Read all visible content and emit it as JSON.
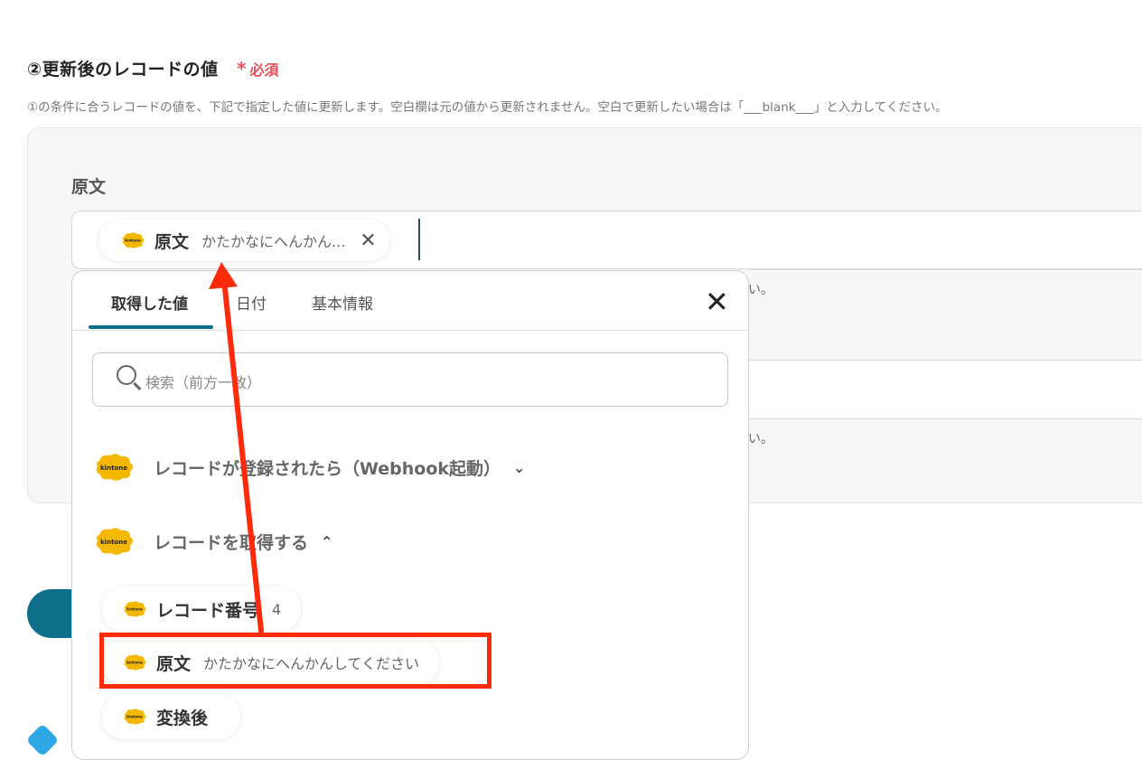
{
  "section": {
    "title": "②更新後のレコードの値",
    "required": "必須",
    "description": "①の条件に合うレコードの値を、下記で指定した値に更新します。空白欄は元の値から更新されません。空白で更新したい場合は「___blank___」と入力してください。"
  },
  "field": {
    "label": "原文",
    "chip": {
      "name": "原文",
      "value": "かたかなにへんかん..."
    },
    "hint_suffix": "い。"
  },
  "popup": {
    "tabs": [
      {
        "label": "取得した値"
      },
      {
        "label": "日付"
      },
      {
        "label": "基本情報"
      }
    ],
    "search_placeholder": "検索（前方一致）",
    "groups": [
      {
        "label": "レコードが登録されたら（Webhook起動）",
        "expanded": false
      },
      {
        "label": "レコードを取得する",
        "expanded": true
      }
    ],
    "items": [
      {
        "name": "レコード番号",
        "value": "4"
      },
      {
        "name": "原文",
        "value": "かたかなにへんかんしてください"
      },
      {
        "name": "変換後",
        "value": ""
      }
    ]
  },
  "icons": {
    "brand_logo": "kintone-logo",
    "logo_text": "kintone",
    "logo_color": "#f5b800"
  },
  "colors": {
    "accent": "#0e6f8a",
    "required": "#e8505b",
    "annotation": "#ff2a0a"
  }
}
